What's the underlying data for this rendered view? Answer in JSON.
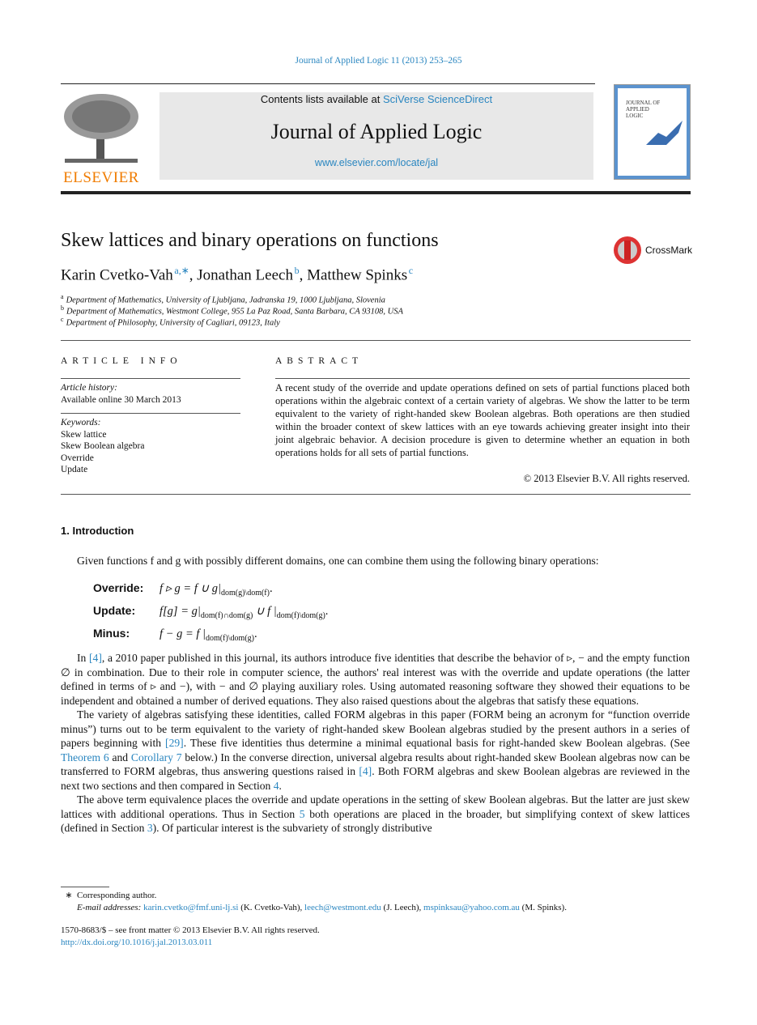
{
  "header": {
    "journal_ref": "Journal of Applied Logic 11 (2013) 253–265",
    "contents_prefix": "Contents lists available at ",
    "contents_link": "SciVerse ScienceDirect",
    "journal_title": "Journal of Applied Logic",
    "journal_url": "www.elsevier.com/locate/jal",
    "publisher": "ELSEVIER",
    "cover_title": "JOURNAL OF APPLIED LOGIC",
    "crossmark": "CrossMark"
  },
  "article": {
    "title": "Skew lattices and binary operations on functions",
    "authors": [
      {
        "name": "Karin Cvetko-Vah",
        "sup": "a,∗"
      },
      {
        "name": "Jonathan Leech",
        "sup": "b"
      },
      {
        "name": "Matthew Spinks",
        "sup": "c"
      }
    ],
    "affiliations": [
      {
        "sup": "a",
        "text": "Department of Mathematics, University of Ljubljana, Jadranska 19, 1000 Ljubljana, Slovenia"
      },
      {
        "sup": "b",
        "text": "Department of Mathematics, Westmont College, 955 La Paz Road, Santa Barbara, CA 93108, USA"
      },
      {
        "sup": "c",
        "text": "Department of Philosophy, University of Cagliari, 09123, Italy"
      }
    ]
  },
  "info": {
    "heading": "ARTICLE INFO",
    "history_label": "Article history:",
    "history_value": "Available online 30 March 2013",
    "keywords_label": "Keywords:",
    "keywords": [
      "Skew lattice",
      "Skew Boolean algebra",
      "Override",
      "Update"
    ]
  },
  "abstract": {
    "heading": "ABSTRACT",
    "text": "A recent study of the override and update operations defined on sets of partial functions placed both operations within the algebraic context of a certain variety of algebras. We show the latter to be term equivalent to the variety of right-handed skew Boolean algebras. Both operations are then studied within the broader context of skew lattices with an eye towards achieving greater insight into their joint algebraic behavior. A decision procedure is given to determine whether an equation in both operations holds for all sets of partial functions.",
    "copyright": "© 2013 Elsevier B.V. All rights reserved."
  },
  "section": {
    "heading": "1.  Introduction",
    "intro": "Given functions f and g with possibly different domains, one can combine them using the following binary operations:",
    "ops": [
      {
        "label": "Override:",
        "formula": "f ▹ g = f ∪ g|",
        "sub": "dom(g)\\dom(f)"
      },
      {
        "label": "Update:",
        "formula": "f[g] = g|",
        "sub": "dom(f)∩dom(g)",
        "formula2": " ∪ f |",
        "sub2": "dom(f)\\dom(g)"
      },
      {
        "label": "Minus:",
        "formula": "f − g = f |",
        "sub": "dom(f)\\dom(g)"
      }
    ],
    "paragraphs": [
      [
        {
          "t": "In "
        },
        {
          "t": "[4]",
          "link": true
        },
        {
          "t": ", a 2010 paper published in this journal, its authors introduce five identities that describe the behavior of ▹, − and the empty function ∅ in combination. Due to their role in computer science, the authors' real interest was with the override and update operations (the latter defined in terms of ▹ and −), with − and ∅ playing auxiliary roles. Using automated reasoning software they showed their equations to be independent and obtained a number of derived equations. They also raised questions about the algebras that satisfy these equations."
        }
      ],
      [
        {
          "t": "The variety of algebras satisfying these identities, called FORM algebras in this paper (FORM being an acronym for “function override minus”) turns out to be term equivalent to the variety of right-handed skew Boolean algebras studied by the present authors in a series of papers beginning with "
        },
        {
          "t": "[29]",
          "link": true
        },
        {
          "t": ". These five identities thus determine a minimal equational basis for right-handed skew Boolean algebras. (See "
        },
        {
          "t": "Theorem 6",
          "link": true
        },
        {
          "t": " and "
        },
        {
          "t": "Corollary 7",
          "link": true
        },
        {
          "t": " below.) In the converse direction, universal algebra results about right-handed skew Boolean algebras now can be transferred to FORM algebras, thus answering questions raised in "
        },
        {
          "t": "[4]",
          "link": true
        },
        {
          "t": ". Both FORM algebras and skew Boolean algebras are reviewed in the next two sections and then compared in Section "
        },
        {
          "t": "4",
          "link": true
        },
        {
          "t": "."
        }
      ],
      [
        {
          "t": "The above term equivalence places the override and update operations in the setting of skew Boolean algebras. But the latter are just skew lattices with additional operations. Thus in Section "
        },
        {
          "t": "5",
          "link": true
        },
        {
          "t": " both operations are placed in the broader, but simplifying context of skew lattices (defined in Section "
        },
        {
          "t": "3",
          "link": true
        },
        {
          "t": "). Of particular interest is the subvariety of strongly distributive"
        }
      ]
    ]
  },
  "footnotes": {
    "star": "∗",
    "corresponding": "Corresponding author.",
    "email_label": "E-mail addresses:",
    "emails": [
      {
        "addr": "karin.cvetko@fmf.uni-lj.si",
        "who": " (K. Cvetko-Vah), "
      },
      {
        "addr": "leech@westmont.edu",
        "who": " (J. Leech), "
      },
      {
        "addr": "mspinksau@yahoo.com.au",
        "who": " (M. Spinks)."
      }
    ],
    "issn": "1570-8683/$ – see front matter  © 2013 Elsevier B.V. All rights reserved.",
    "doi": "http://dx.doi.org/10.1016/j.jal.2013.03.011"
  },
  "colors": {
    "link": "#2a86c0",
    "publisher": "#f07c00",
    "cover": "#6a9fd0"
  }
}
